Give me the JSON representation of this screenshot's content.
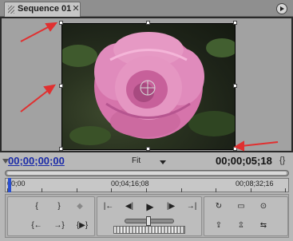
{
  "panel": {
    "tab_title": "Sequence 01",
    "tab_close_glyph": "✕",
    "menu_icon": "panel-menu-icon"
  },
  "monitor": {
    "current_timecode": "00;00;00;00",
    "zoom_label": "Fit",
    "duration_timecode": "00;00;05;18",
    "duration_icon_glyph": "{}"
  },
  "ruler": {
    "tick_labels": [
      "00;00",
      "00;04;16;08",
      "00;08;32;16"
    ]
  },
  "controls": {
    "mark_in": "{",
    "mark_out": "}",
    "set_marker": "◆",
    "go_to_in": "{←",
    "go_to_out": "→}",
    "play_in_to_out": "{▶}",
    "step_back_edit": "|←",
    "step_back": "◀|",
    "play": "▶",
    "step_forward": "|▶",
    "step_forward_edit": "→|",
    "loop": "↻",
    "safe_margins": "▭",
    "output": "⊙",
    "lift": "⇪",
    "extract": "⇫",
    "trim": "⇆"
  },
  "colors": {
    "current_timecode": "#1a2aa8",
    "annotation_arrows": "#e03030",
    "playhead": "#2a4fcf"
  }
}
